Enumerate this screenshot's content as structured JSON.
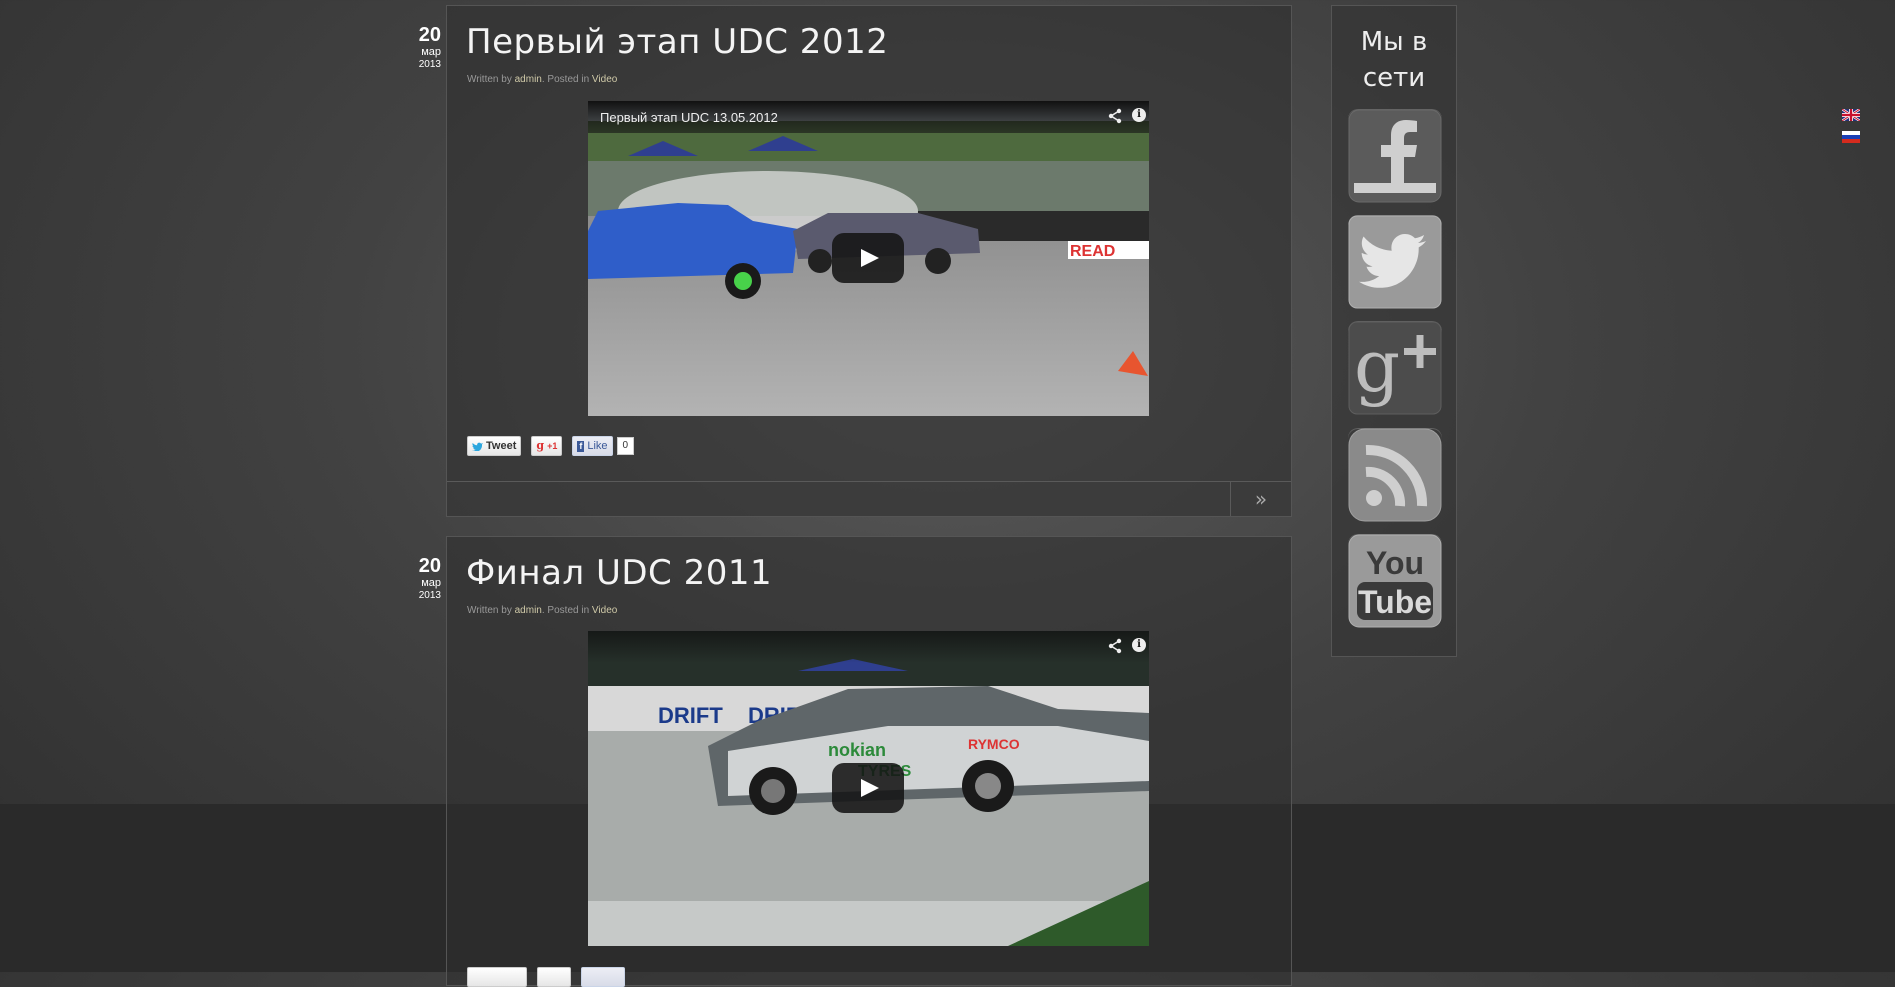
{
  "articles": [
    {
      "date": {
        "day": "20",
        "month": "мар",
        "year": "2013"
      },
      "title": "Первый этап UDC 2012",
      "meta": {
        "written_by": "Written by",
        "author": "admin",
        "posted_in": ". Posted in",
        "category": "Video"
      },
      "video": {
        "title": "Первый этап UDC 13.05.2012",
        "info_glyph": "i"
      },
      "share": {
        "tweet": "Tweet",
        "gplus": "+1",
        "fb_like": "Like",
        "fb_count": "0"
      },
      "readmore_glyph": "»"
    },
    {
      "date": {
        "day": "20",
        "month": "мар",
        "year": "2013"
      },
      "title": "Финал UDC 2011",
      "meta": {
        "written_by": "Written by",
        "author": "admin",
        "posted_in": ". Posted in",
        "category": "Video"
      },
      "video": {
        "title": "",
        "info_glyph": "i"
      }
    }
  ],
  "sidebar": {
    "heading_line1": "Мы в",
    "heading_line2": "сети",
    "icons": [
      "facebook-icon",
      "twitter-icon",
      "google-plus-icon",
      "rss-icon",
      "youtube-icon"
    ],
    "youtube_text": {
      "top": "You",
      "bottom": "Tube"
    }
  },
  "flags": [
    "uk-flag-icon",
    "ru-flag-icon"
  ]
}
